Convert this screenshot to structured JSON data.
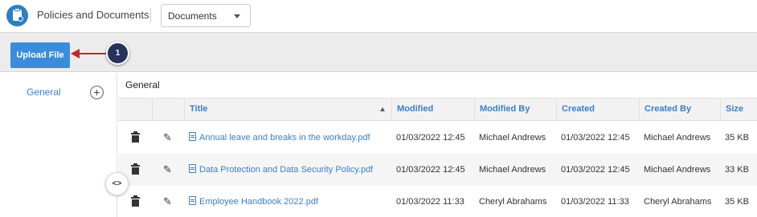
{
  "header": {
    "app_title": "Policies and Documents",
    "section_select": "Documents"
  },
  "toolbar": {
    "upload_label": "Upload File",
    "step_badge": "1"
  },
  "sidebar": {
    "items": [
      {
        "label": "General"
      }
    ],
    "add_symbol": "+",
    "toggle_symbol": "<>"
  },
  "main": {
    "folder_title": "General",
    "columns": [
      "Title",
      "Modified",
      "Modified By",
      "Created",
      "Created By",
      "Size"
    ],
    "rows": [
      {
        "title": "Annual leave and breaks in the workday.pdf",
        "modified": "01/03/2022 12:45",
        "modified_by": "Michael Andrews",
        "created": "01/03/2022 12:45",
        "created_by": "Michael Andrews",
        "size": "35 KB"
      },
      {
        "title": "Data Protection and Data Security Policy.pdf",
        "modified": "01/03/2022 12:45",
        "modified_by": "Michael Andrews",
        "created": "01/03/2022 12:45",
        "created_by": "Michael Andrews",
        "size": "33 KB"
      },
      {
        "title": "Employee Handbook 2022.pdf",
        "modified": "01/03/2022 11:33",
        "modified_by": "Cheryl Abrahams",
        "created": "01/03/2022 11:33",
        "created_by": "Cheryl Abrahams",
        "size": "35 KB"
      }
    ]
  },
  "colors": {
    "accent": "#3a8ddc",
    "link": "#3a7fc6",
    "callout_arrow": "#c0282d",
    "badge": "#26335a"
  }
}
